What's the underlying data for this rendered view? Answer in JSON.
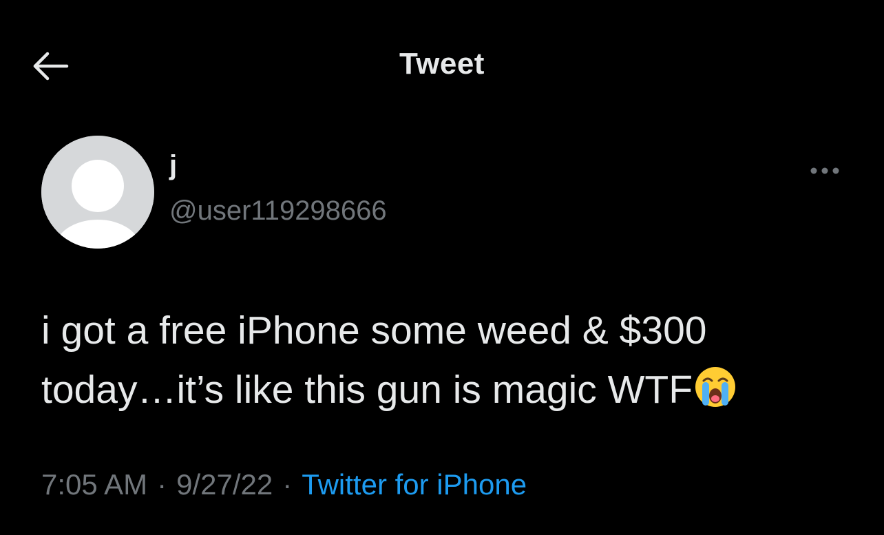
{
  "header": {
    "title": "Tweet",
    "back_icon": "arrow-left-icon"
  },
  "tweet": {
    "author": {
      "display_name": "j",
      "handle": "@user119298666",
      "avatar_icon": "default-avatar-icon"
    },
    "more_icon": "more-horizontal-icon",
    "text_line1": "i got a free iPhone some weed & $300",
    "text_line2": "today…it’s like this gun is magic WTF",
    "emoji_name": "loudly-crying-face-emoji",
    "time": "7:05 AM",
    "separator1": "·",
    "date": "9/27/22",
    "separator2": "·",
    "source": "Twitter for iPhone"
  },
  "colors": {
    "background": "#000000",
    "primary_text": "#e7e9ea",
    "secondary_text": "#71767b",
    "link": "#1d9bf0",
    "avatar_bg": "#d6d8da"
  }
}
